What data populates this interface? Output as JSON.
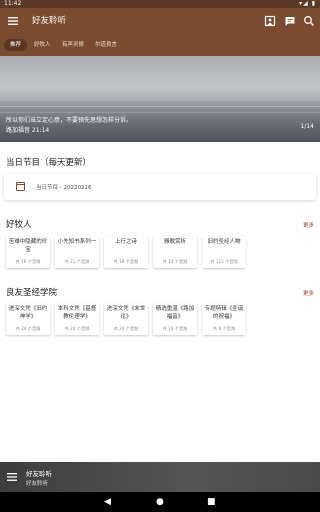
{
  "status_bar": {
    "time": "11:42",
    "system_icons": "▾◢ ▮"
  },
  "app_bar": {
    "title": "好友聆听",
    "menu_icon": "hamburger-icon",
    "actions": [
      "photo-icon",
      "message-icon",
      "search-icon"
    ]
  },
  "tabs": [
    {
      "label": "推荐",
      "active": true
    },
    {
      "label": "好牧人"
    },
    {
      "label": "有声灵修"
    },
    {
      "label": "尔道良言"
    }
  ],
  "banner": {
    "caption_line1": "所以你们当立定心意，不要预先思想怎样分诉。",
    "caption_line2": "路加福音 21:14",
    "pager": "1/14"
  },
  "daily": {
    "title": "当日节目（每天更新）",
    "card_label": "当日节目 - 20220216"
  },
  "shepherd": {
    "title": "好牧人",
    "more": "更多",
    "cards": [
      {
        "title": "苦难中隐藏的珍宝",
        "count": "共 16 个音频"
      },
      {
        "title": "小先知书系列一",
        "count": "共 21 个音频"
      },
      {
        "title": "上行之诗",
        "count": "共 18 个音频"
      },
      {
        "title": "雅歌赏析",
        "count": "共 14 个音频"
      },
      {
        "title": "旧约圣经人物",
        "count": "共 112 个音频"
      }
    ]
  },
  "academy": {
    "title": "良友圣经学院",
    "more": "更多",
    "cards": [
      {
        "title": "进深文凭《旧约神学》",
        "count": "共 24 个音频"
      },
      {
        "title": "本科文凭《基督教伦理学》",
        "count": "共 24 个音频"
      },
      {
        "title": "进深文凭《末世论》",
        "count": "共 24 个音频"
      },
      {
        "title": "精选重温《路加福音》",
        "count": "共 24 个音频"
      },
      {
        "title": "专题特辑《圣诞的祝福》",
        "count": "共 6 个音频"
      }
    ]
  },
  "player": {
    "title": "好友聆听",
    "subtitle": "好友聆听"
  },
  "nav": {
    "back": "◀",
    "home": "●",
    "recent": "■"
  }
}
